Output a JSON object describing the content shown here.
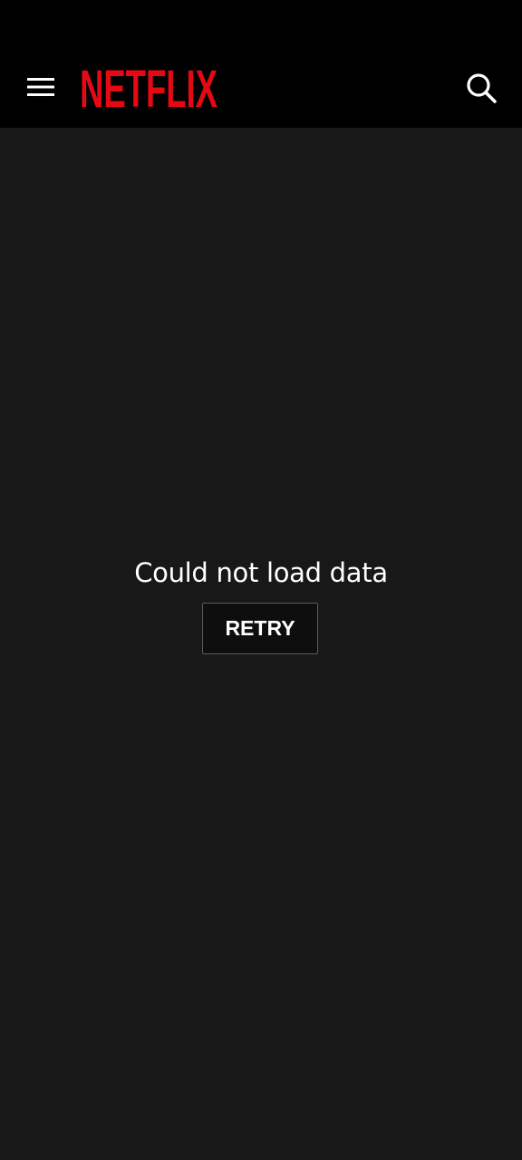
{
  "header": {
    "logo_text": "NETFLIX",
    "menu_icon": "hamburger-menu-icon",
    "search_icon": "search-icon",
    "brand_color": "#E50914"
  },
  "main": {
    "error_message": "Could not load data",
    "retry_label": "RETRY"
  }
}
